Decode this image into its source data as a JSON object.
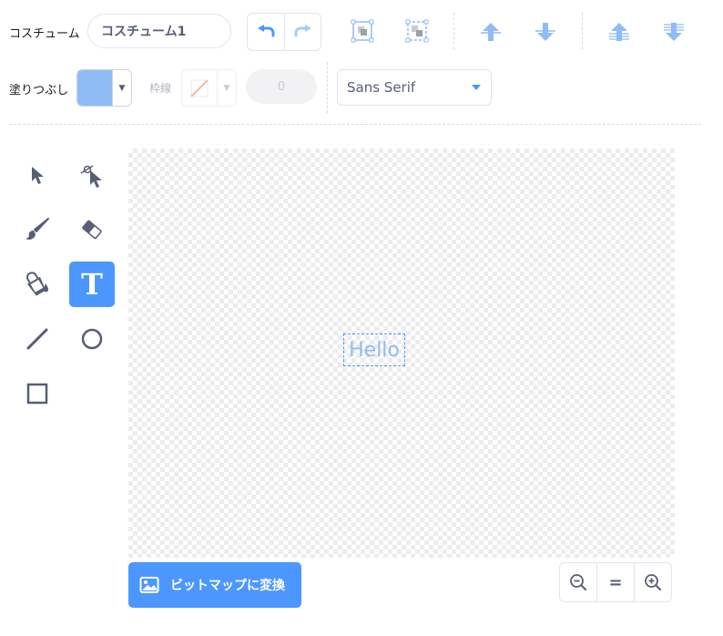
{
  "toolbar": {
    "costume_label": "コスチューム",
    "costume_name": "コスチューム1",
    "undo_icon": "undo-icon",
    "redo_icon": "redo-icon",
    "group_icon": "group-icon",
    "ungroup_icon": "ungroup-icon",
    "forward_icon": "forward-icon",
    "backward_icon": "backward-icon",
    "front_icon": "front-icon",
    "back_icon": "back-icon"
  },
  "style_bar": {
    "fill_label": "塗りつぶし",
    "fill_color": "#8fbcf5",
    "outline_label": "枠線",
    "outline_width": "0",
    "font": "Sans Serif"
  },
  "tools": [
    {
      "name": "select",
      "icon": "select-arrow-icon",
      "active": false
    },
    {
      "name": "reshape",
      "icon": "reshape-icon",
      "active": false
    },
    {
      "name": "brush",
      "icon": "brush-icon",
      "active": false
    },
    {
      "name": "eraser",
      "icon": "eraser-icon",
      "active": false
    },
    {
      "name": "fill",
      "icon": "fill-bucket-icon",
      "active": false
    },
    {
      "name": "text",
      "icon": "text-icon",
      "active": true
    },
    {
      "name": "line",
      "icon": "line-icon",
      "active": false
    },
    {
      "name": "circle",
      "icon": "circle-icon",
      "active": false
    },
    {
      "name": "rectangle",
      "icon": "rectangle-icon",
      "active": false
    }
  ],
  "canvas": {
    "text": "Hello"
  },
  "bottom": {
    "convert_label": "ビットマップに変換",
    "zoom_reset_label": "="
  },
  "colors": {
    "accent": "#4c97ff",
    "fill": "#8fbcf5",
    "text_color": "#575e75"
  }
}
